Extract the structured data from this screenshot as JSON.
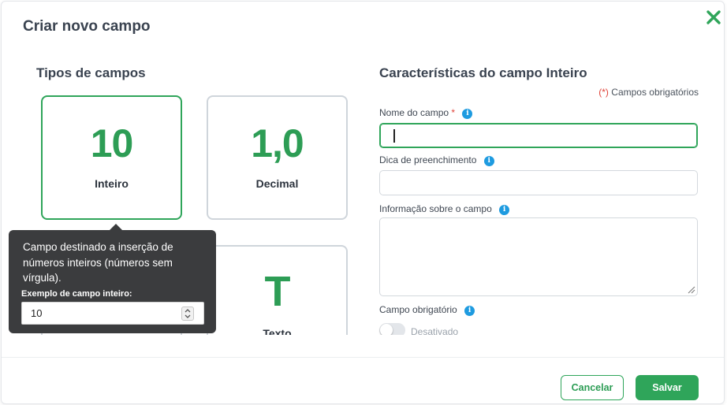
{
  "dialog": {
    "title": "Criar novo campo",
    "colors": {
      "accent": "#2fa55a",
      "required": "#e0443a",
      "info": "#1e9be0"
    }
  },
  "types_section": {
    "title": "Tipos de campos",
    "cards": [
      {
        "glyph": "10",
        "label": "Inteiro",
        "selected": true
      },
      {
        "glyph": "1,0",
        "label": "Decimal",
        "selected": false
      },
      {
        "glyph": "",
        "label": "",
        "selected": false
      },
      {
        "glyph": "T",
        "label": "Texto",
        "selected": false
      }
    ]
  },
  "tooltip": {
    "text": "Campo destinado a inserção de números inteiros (números sem vírgula).",
    "example_label": "Exemplo de campo inteiro:",
    "example_value": "10"
  },
  "form": {
    "title": "Características do campo Inteiro",
    "required_note_mark": "(*)",
    "required_note_text": "Campos obrigatórios",
    "name_label": "Nome do campo",
    "name_required_mark": "*",
    "name_value": "",
    "hint_label": "Dica de preenchimento",
    "hint_value": "",
    "info_label": "Informação sobre o campo",
    "info_value": "",
    "required_label": "Campo obrigatório",
    "required_toggle_label": "Desativado",
    "required_toggle_on": false
  },
  "footer": {
    "cancel_label": "Cancelar",
    "save_label": "Salvar"
  },
  "icons": {
    "close": "close-icon",
    "info": "info-icon",
    "spinner": "spinner-icon",
    "resize": "resize-grip-icon"
  }
}
